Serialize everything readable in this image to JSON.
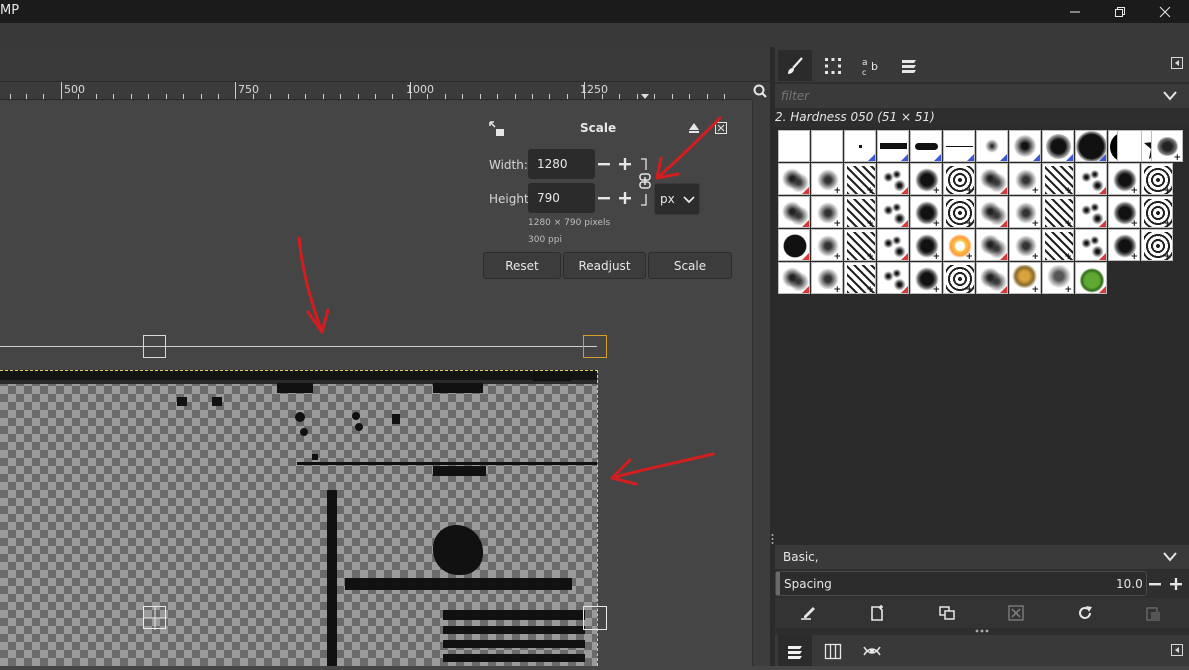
{
  "window": {
    "title": "MP"
  },
  "ruler": {
    "labels": [
      "500",
      "750",
      "1000",
      "1250"
    ]
  },
  "scale_dialog": {
    "title": "Scale",
    "width_label": "Width:",
    "width_value": "1280",
    "height_label": "Height:",
    "height_value": "790",
    "unit": "px",
    "info_pixels": "1280 × 790 pixels",
    "info_ppi": "300 ppi",
    "buttons": {
      "reset": "Reset",
      "readjust": "Readjust",
      "scale": "Scale"
    }
  },
  "brushes_panel": {
    "filter_placeholder": "filter",
    "selected_brush": "2. Hardness 050 (51 × 51)",
    "tag": "Basic,",
    "spacing_label": "Spacing",
    "spacing_value": "10.0"
  },
  "colors": {
    "arrow": "#d21e1e",
    "selection": "#e0d060",
    "handle_active": "#d4a028"
  }
}
